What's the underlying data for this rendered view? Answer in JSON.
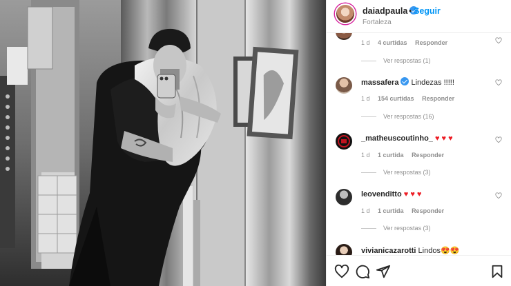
{
  "post": {
    "username": "daiadpaula",
    "follow_label": "Seguir",
    "separator": "•",
    "location": "Fortaleza",
    "verified": true
  },
  "comments": [
    {
      "username": "",
      "text": "",
      "time": "1 d",
      "likes": "4 curtidas",
      "reply": "Responder",
      "view_replies": "Ver respostas (1)",
      "avatar": "avatar-partial"
    },
    {
      "username": "massafera",
      "verified": true,
      "text": "Lindezas !!!!!",
      "time": "1 d",
      "likes": "154 curtidas",
      "reply": "Responder",
      "view_replies": "Ver respostas (16)",
      "avatar": "avatar-massafera"
    },
    {
      "username": "_matheuscoutinho_",
      "text": "♥ ♥ ♥",
      "time": "1 d",
      "likes": "1 curtida",
      "reply": "Responder",
      "view_replies": "Ver respostas (3)",
      "avatar": "avatar-matheus"
    },
    {
      "username": "leovenditto",
      "text": "♥ ♥ ♥",
      "time": "1 d",
      "likes": "1 curtida",
      "reply": "Responder",
      "view_replies": "Ver respostas (3)",
      "avatar": "avatar-leo"
    },
    {
      "username": "vivianicazarotti",
      "text": "Lindos😍😍",
      "avatar": "avatar-viviani"
    }
  ],
  "icons": {
    "like": "heart-outline-icon",
    "comment": "comment-bubble-icon",
    "share": "send-icon",
    "save": "bookmark-icon",
    "comment_like": "small-heart-icon"
  },
  "colors": {
    "accent": "#0095f6",
    "verified": "#3897f0",
    "heart": "#ed1c24",
    "muted": "#8e8e8e"
  }
}
